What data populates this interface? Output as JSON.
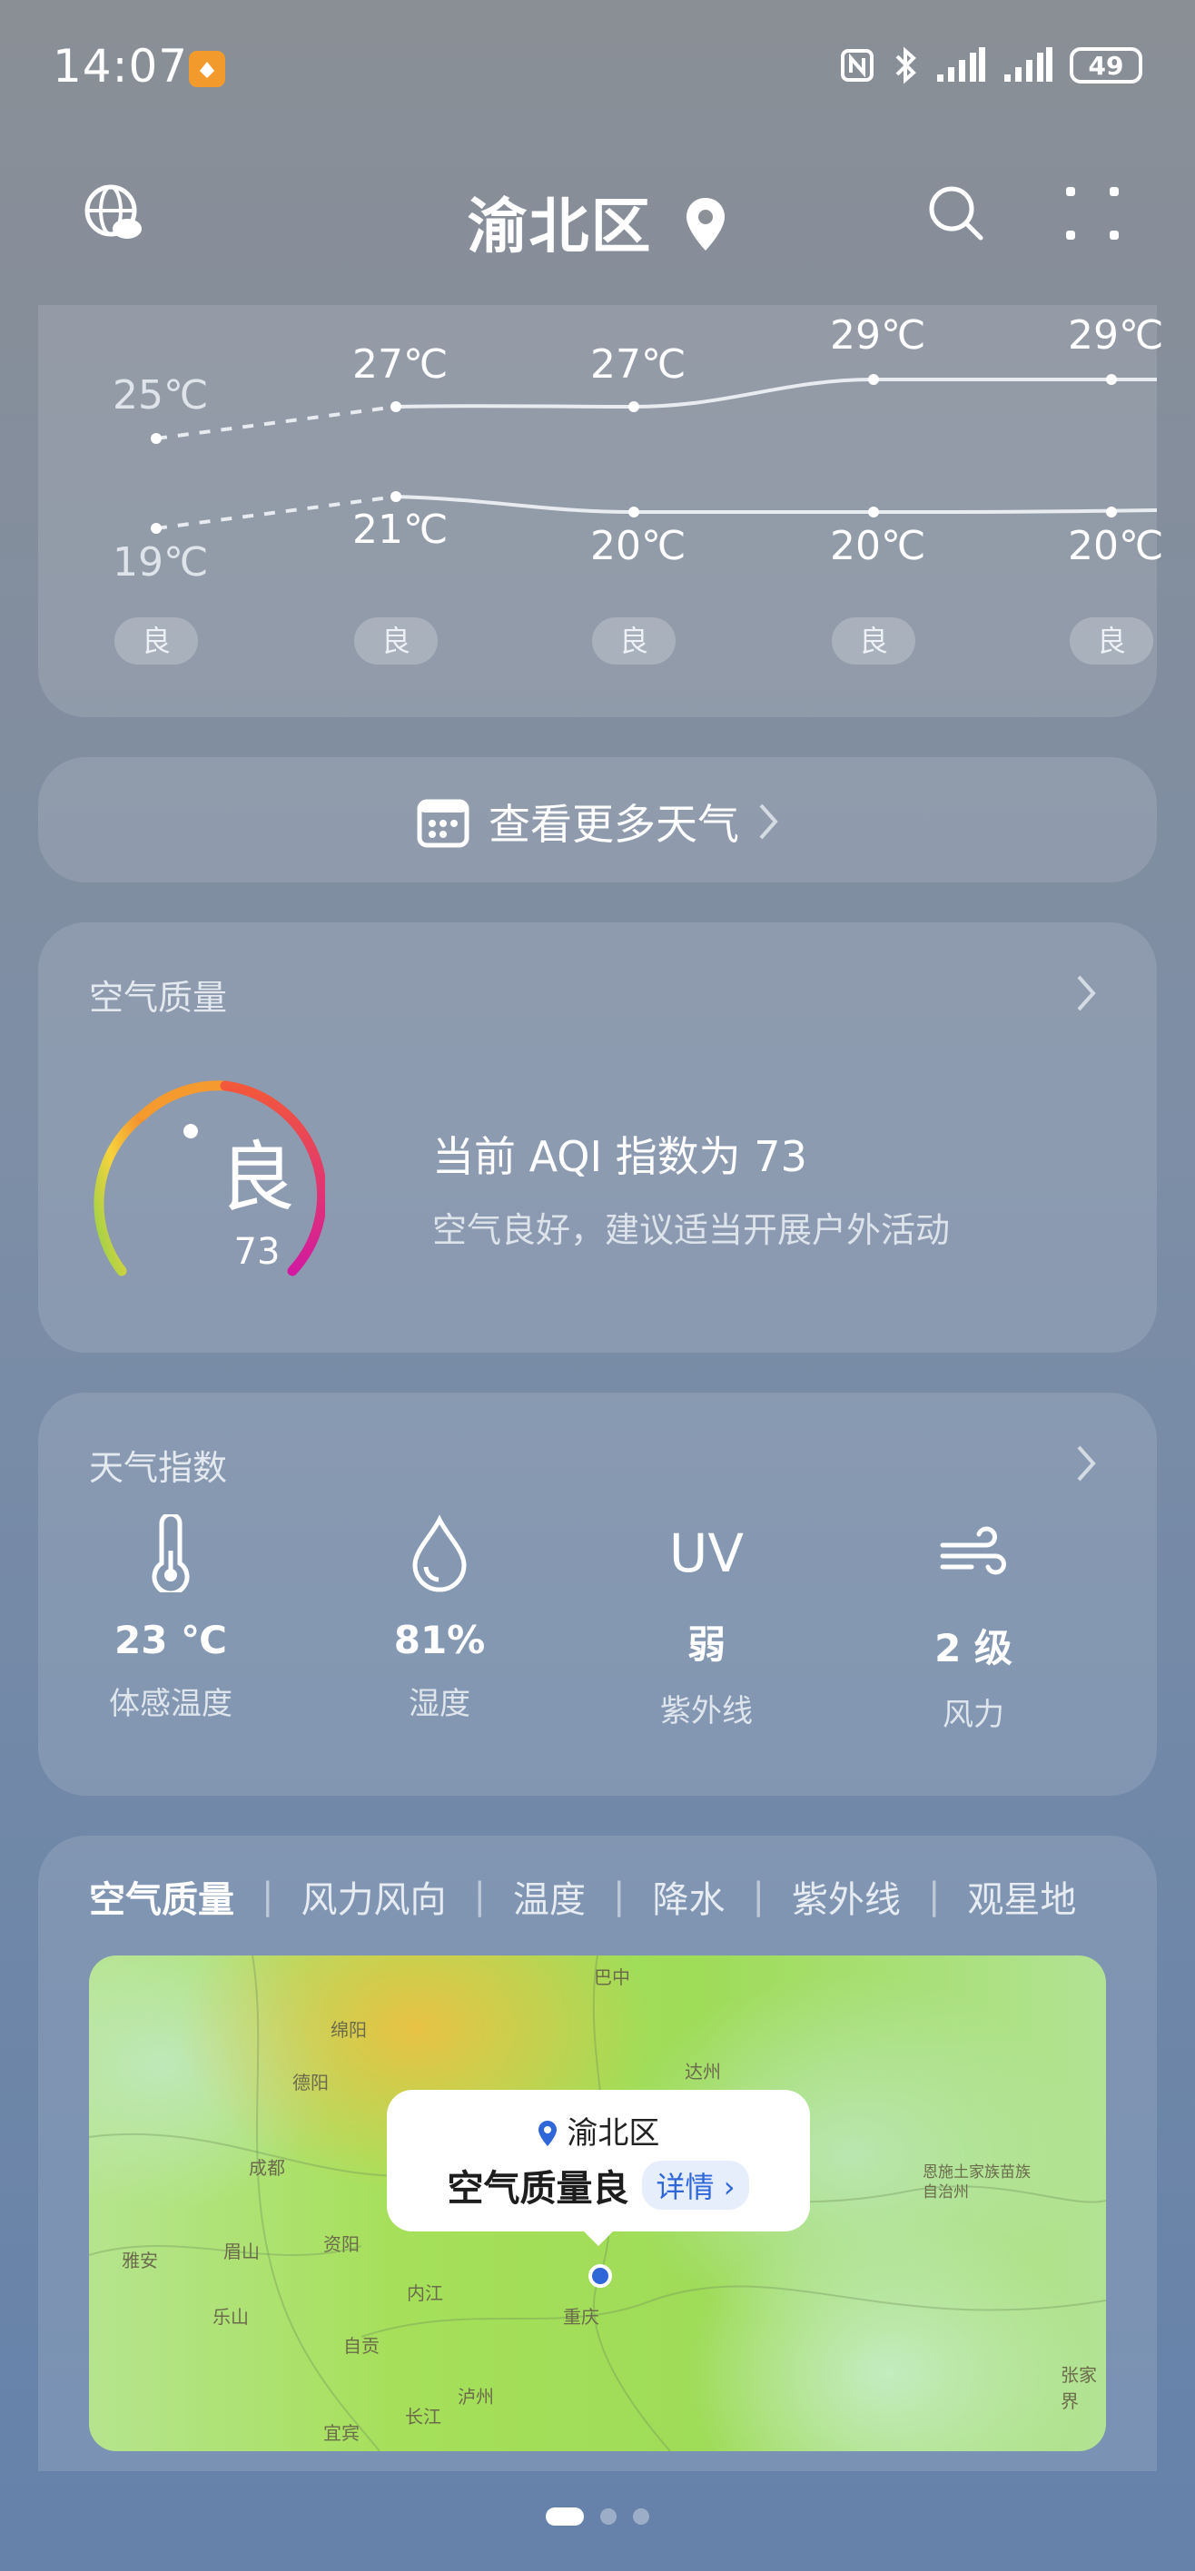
{
  "status": {
    "time": "14:07",
    "battery": "49"
  },
  "header": {
    "location": "渝北区"
  },
  "forecast": {
    "highs": [
      "25℃",
      "27℃",
      "27℃",
      "29℃",
      "29℃"
    ],
    "lows": [
      "19℃",
      "21℃",
      "20℃",
      "20℃",
      "20℃"
    ],
    "aqi": [
      "良",
      "良",
      "良",
      "良",
      "良"
    ]
  },
  "more_weather": {
    "label": "查看更多天气"
  },
  "air_quality": {
    "title": "空气质量",
    "level": "良",
    "value": "73",
    "headline": "当前 AQI 指数为 73",
    "advice": "空气良好，建议适当开展户外活动"
  },
  "weather_index": {
    "title": "天气指数",
    "items": [
      {
        "icon": "thermometer-icon",
        "value": "23 ℃",
        "label": "体感温度"
      },
      {
        "icon": "humidity-drop-icon",
        "value": "81%",
        "label": "湿度"
      },
      {
        "icon": "uv-icon",
        "icon_text": "UV",
        "value": "弱",
        "label": "紫外线"
      },
      {
        "icon": "wind-icon",
        "value": "2 级",
        "label": "风力"
      }
    ]
  },
  "map_tabs": [
    "空气质量",
    "风力风向",
    "温度",
    "降水",
    "紫外线",
    "观星地"
  ],
  "map": {
    "cities": [
      "巴中",
      "绵阳",
      "达州",
      "德阳",
      "成都",
      "雅安",
      "眉山",
      "资阳",
      "内江",
      "乐山",
      "自贡",
      "泸州",
      "宜宾",
      "长江",
      "重庆",
      "恩施土家族苗族自治州",
      "张家界"
    ],
    "popup": {
      "location": "渝北区",
      "text": "空气质量良",
      "detail": "详情"
    }
  }
}
